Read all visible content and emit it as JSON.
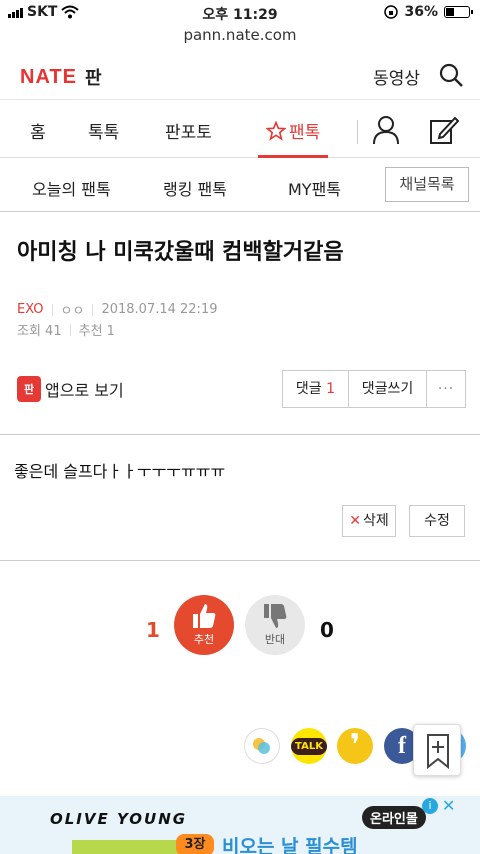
{
  "status": {
    "carrier": "SKT",
    "time": "오후 11:29",
    "battery": "36%",
    "battery_level": 0.36
  },
  "url": "pann.nate.com",
  "header": {
    "logo": "NATE",
    "section": "판",
    "video": "동영상"
  },
  "gnb": {
    "tabs": [
      "홈",
      "톡톡",
      "판포토",
      "팬톡"
    ],
    "active_tab": "팬톡",
    "accent": "#e53935"
  },
  "subnav": {
    "items": [
      "오늘의 팬톡",
      "랭킹 팬톡",
      "MY팬톡"
    ],
    "channel_button": "채널목록"
  },
  "post": {
    "title": "아미칭 나 미쿡갔울때 컴백할거같음",
    "author": "EXO",
    "nickname": "ㅇㅇ",
    "date": "2018.07.14 22:19",
    "views": "조회 41",
    "recommend": "추천 1",
    "body": "좋은데 슬프다ㅏㅏㅜㅜㅜㅠㅠㅠ"
  },
  "actions": {
    "app_view": "앱으로 보기",
    "app_icon_text": "판",
    "comment_label": "댓글",
    "comment_count": "1",
    "write_comment": "댓글쓰기",
    "more": "···",
    "delete": "삭제",
    "edit": "수정"
  },
  "vote": {
    "up_count": "1",
    "up_label": "추천",
    "down_label": "반대",
    "down_count": "0"
  },
  "share": {
    "kakaotalk": "TALK"
  },
  "ad": {
    "brand": "OLIVE YOUNG",
    "online": "온라인몰",
    "sticker": "3장",
    "slogan": "비오는 날 필수템"
  }
}
